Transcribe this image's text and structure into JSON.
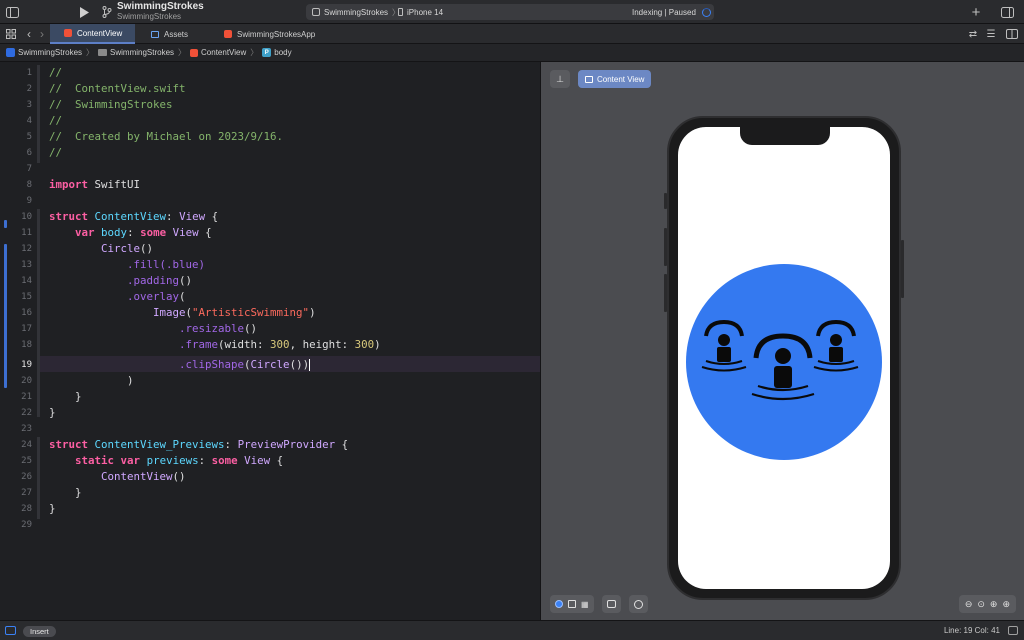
{
  "titlebar": {
    "project_name": "SwimmingStrokes",
    "project_subtitle": "SwimmingStrokes",
    "scheme": "SwimmingStrokes",
    "device": "iPhone 14",
    "status": "Indexing | Paused"
  },
  "tabs": [
    {
      "label": "ContentView"
    },
    {
      "label": "Assets"
    },
    {
      "label": "SwimmingStrokesApp"
    }
  ],
  "breadcrumb": {
    "project": "SwimmingStrokes",
    "folder": "SwimmingStrokes",
    "file": "ContentView",
    "symbol": "body",
    "symbol_badge": "P"
  },
  "editor": {
    "current_line": 19,
    "line_numbers": [
      "1",
      "2",
      "3",
      "4",
      "5",
      "6",
      "7",
      "8",
      "9",
      "10",
      "11",
      "12",
      "13",
      "14",
      "15",
      "16",
      "17",
      "18",
      "19",
      "20",
      "21",
      "22",
      "23",
      "24",
      "25",
      "26",
      "27",
      "28",
      "29"
    ],
    "code": {
      "l1": "//",
      "l2": "//  ContentView.swift",
      "l3": "//  SwimmingStrokes",
      "l4": "//",
      "l5": "//  Created by Michael on 2023/9/16.",
      "l6": "//",
      "l8_kw": "import",
      "l8_rest": " SwiftUI",
      "l10_kw": "struct",
      "l10_name": "ContentView",
      "l10_colon": ": ",
      "l10_type": "View",
      "l10_end": " {",
      "l11_kw": "var",
      "l11_name": "body",
      "l11_colon": ": ",
      "l11_kw2": "some",
      "l11_type": "View",
      "l11_end": " {",
      "l12_type": "Circle",
      "l12_end": "()",
      "l13_fn": ".fill",
      "l13_arg": "(.blue)",
      "l14_fn": ".padding",
      "l14_end": "()",
      "l15_fn": ".overlay",
      "l15_end": "(",
      "l16_type": "Image",
      "l16_open": "(",
      "l16_str": "\"ArtisticSwimming\"",
      "l16_close": ")",
      "l17_fn": ".resizable",
      "l17_end": "()",
      "l18_fn": ".frame",
      "l18_p1": "(width: ",
      "l18_n1": "300",
      "l18_p2": ", height: ",
      "l18_n2": "300",
      "l18_end": ")",
      "l19_fn": ".clipShape",
      "l19_open": "(",
      "l19_type": "Circle",
      "l19_end": "())",
      "l20": ")",
      "l21": "}",
      "l22": "}",
      "l24_kw": "struct",
      "l24_name": "ContentView_Previews",
      "l24_colon": ": ",
      "l24_type": "PreviewProvider",
      "l24_end": " {",
      "l25_kw": "static",
      "l25_kw2": "var",
      "l25_name": "previews",
      "l25_colon": ": ",
      "l25_kw3": "some",
      "l25_type": "View",
      "l25_end": " {",
      "l26_type": "ContentView",
      "l26_end": "()",
      "l27": "}",
      "l28": "}"
    }
  },
  "preview": {
    "chip_label": "Content View",
    "circle_color": "#3479f0",
    "image_name": "ArtisticSwimming"
  },
  "statusbar": {
    "mode": "Insert",
    "position": "Line: 19  Col: 41"
  },
  "colors": {
    "keyword": "#fc5fa3",
    "type": "#5dd8ff",
    "comment": "#84b46b",
    "string": "#fc6a5d",
    "number": "#d9c97c",
    "accent": "#3b82f6"
  }
}
